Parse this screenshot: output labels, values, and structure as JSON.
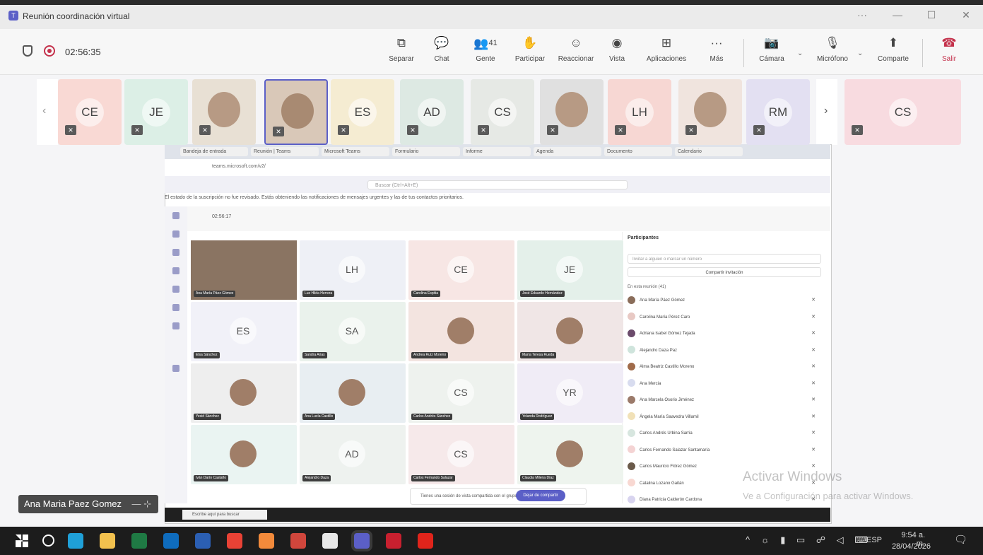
{
  "window": {
    "title": "Reunión coordinación virtual",
    "controls": [
      "···",
      "—",
      "☐",
      "✕"
    ]
  },
  "meeting": {
    "timer": "02:56:35"
  },
  "toolbar": {
    "separar": "Separar",
    "chat": "Chat",
    "gente": "Gente",
    "gente_count": "41",
    "participar": "Participar",
    "reaccionar": "Reaccionar",
    "vista": "Vista",
    "aplicaciones": "Aplicaciones",
    "mas": "Más",
    "camara": "Cámara",
    "microfono": "Micrófono",
    "compartir": "Comparte",
    "salir": "Salir"
  },
  "strip": {
    "tiles": [
      {
        "initials": "CE",
        "color": "#f9d9d4"
      },
      {
        "initials": "JE",
        "color": "#dcefe6"
      },
      {
        "initials": "",
        "color": "#e8e0d4",
        "photo": true
      },
      {
        "initials": "",
        "color": "#d9c8b8",
        "photo": true,
        "active": true
      },
      {
        "initials": "ES",
        "color": "#f5ecd2"
      },
      {
        "initials": "AD",
        "color": "#dde9e3"
      },
      {
        "initials": "CS",
        "color": "#e6e9e5"
      },
      {
        "initials": "",
        "color": "#e0e0e0",
        "photo": true
      },
      {
        "initials": "LH",
        "color": "#f7d7d3"
      },
      {
        "initials": "",
        "color": "#f0e4de",
        "photo": true
      },
      {
        "initials": "RM",
        "color": "#e3e0f2"
      },
      {
        "initials": "CS",
        "color": "#f8dbe0"
      }
    ]
  },
  "shared_screen": {
    "tabs": [
      "Bandeja de entrada",
      "Reunión | Teams",
      "Microsoft Teams",
      "Formulario",
      "Informe",
      "Agenda",
      "Documento",
      "Calendario"
    ],
    "url": "teams.microsoft.com/v2/",
    "search_placeholder": "Buscar (Ctrl+Alt+E)",
    "banner": "El estado de la suscripción no fue revisado. Estás obteniendo las notificaciones de mensajes urgentes y las de tus contactos prioritarios.",
    "meeting_timer": "02:56:17",
    "grid": [
      {
        "initials": "",
        "name": "Ana María Páez Gómez",
        "photo": true,
        "color": "#6b5a4a"
      },
      {
        "initials": "LH",
        "name": "Luz Hilda Herrera",
        "color": "#eef0f6"
      },
      {
        "initials": "CE",
        "name": "Carolina Espitia",
        "color": "#f7e6e4"
      },
      {
        "initials": "JE",
        "name": "José Eduardo Hernández",
        "color": "#e4f0ea"
      },
      {
        "initials": "ES",
        "name": "Elsa Sánchez",
        "color": "#f1f1f8"
      },
      {
        "initials": "SA",
        "name": "Sandra Arias",
        "color": "#eaf2ec"
      },
      {
        "initials": "",
        "name": "Andrea Ruíz Moreno",
        "photo": true,
        "color": "#f3e4e0"
      },
      {
        "initials": "",
        "name": "María Teresa Rueda",
        "photo": true,
        "color": "#f0e6e6"
      },
      {
        "initials": "",
        "name": "Yesid Sánchez",
        "photo": true,
        "color": "#eeeeee"
      },
      {
        "initials": "",
        "name": "Ana Lucía Castillo",
        "photo": true,
        "color": "#e8eef2"
      },
      {
        "initials": "CS",
        "name": "Carlos Andrés Sánchez",
        "color": "#eef2ee"
      },
      {
        "initials": "YR",
        "name": "Yolanda Rodríguez",
        "color": "#f0ecf6"
      },
      {
        "initials": "",
        "name": "Iván Darío Castaño",
        "photo": true,
        "color": "#eaf4f2"
      },
      {
        "initials": "AD",
        "name": "Alejandro Daza",
        "color": "#eef2ef"
      },
      {
        "initials": "CS",
        "name": "Carlos Fernando Salazar",
        "color": "#f6e9ea"
      },
      {
        "initials": "",
        "name": "Claudia Milena Díaz",
        "photo": true,
        "color": "#eef4ee"
      }
    ],
    "participants": {
      "title": "Participantes",
      "search_placeholder": "Invitar a alguien o marcar un número",
      "share_label": "Compartir invitación",
      "section": "En esta reunión (41)",
      "people": [
        {
          "name": "Ana María Páez Gómez",
          "color": "#8a6d5a"
        },
        {
          "name": "Carolina María Pérez Caro",
          "color": "#e8c9c4"
        },
        {
          "name": "Adriana Isabel Gómez Tejada",
          "color": "#6b4b6b"
        },
        {
          "name": "Alejandro Daza Paz",
          "color": "#cfe4dc"
        },
        {
          "name": "Alma Beatriz Castillo Moreno",
          "color": "#a06b4a"
        },
        {
          "name": "Ana Mercia",
          "color": "#d8dcef"
        },
        {
          "name": "Ana Marcela Osorio Jiménez",
          "color": "#9b7a6a"
        },
        {
          "name": "Ángela María Saavedra Villamil",
          "color": "#f1e1b8"
        },
        {
          "name": "Carlos Andrés Urbina Sarria",
          "color": "#d7e6df"
        },
        {
          "name": "Carlos Fernando Salazar Santamaría",
          "color": "#f4d3d3"
        },
        {
          "name": "Carlos Mauricio Flórez Gómez",
          "color": "#6a5a4a"
        },
        {
          "name": "Catalina Lozano Gaitán",
          "color": "#f8d8d2"
        },
        {
          "name": "Diana Patricia Calderón Cardona",
          "color": "#d8d4ef"
        }
      ]
    },
    "share_bar_text": "Tienes una sesión de vista compartida con el grupo",
    "stop_label": "Dejar de compartir",
    "taskbar_search": "Escribe aquí para buscar"
  },
  "watermark": {
    "line1": "Activar Windows",
    "line2": "Ve a Configuración para activar Windows."
  },
  "self": {
    "name": "Ana Maria Paez Gomez"
  },
  "taskbar": {
    "lang": "ESP",
    "time": "9:54 a. m.",
    "date": "28/04/2026",
    "apps": [
      {
        "name": "windows-start-icon",
        "color": "#ffffff"
      },
      {
        "name": "search-icon",
        "color": "#ffffff"
      },
      {
        "name": "edge-icon",
        "color": "#1fa0d8"
      },
      {
        "name": "file-explorer-icon",
        "color": "#f2c14e"
      },
      {
        "name": "excel-icon",
        "color": "#1f7a44"
      },
      {
        "name": "outlook-icon",
        "color": "#0f6cbd"
      },
      {
        "name": "word-icon",
        "color": "#2b5fb3"
      },
      {
        "name": "chrome-icon",
        "color": "#e94235"
      },
      {
        "name": "paint-icon",
        "color": "#f28a3b"
      },
      {
        "name": "powerpoint-icon",
        "color": "#d0463c"
      },
      {
        "name": "app-icon",
        "color": "#e8e8e8"
      },
      {
        "name": "teams-icon",
        "color": "#5b5fc7"
      },
      {
        "name": "mcafee-icon",
        "color": "#c8202f"
      },
      {
        "name": "acrobat-icon",
        "color": "#e0241b"
      }
    ]
  }
}
